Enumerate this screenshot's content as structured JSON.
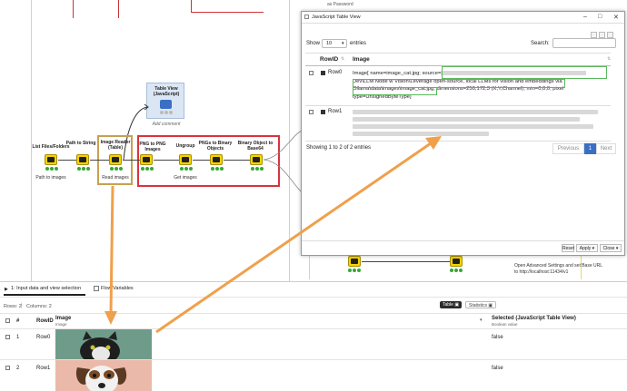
{
  "canvas": {
    "top_text": "as Password",
    "nodes": [
      {
        "title": "List Files/Folders",
        "sub": "Path to images"
      },
      {
        "title": "Path to String",
        "sub": ""
      },
      {
        "title": "Image Reader (Table)",
        "sub": "Read images"
      },
      {
        "title": "PNG to PNG Images",
        "sub": ""
      },
      {
        "title": "Ungroup",
        "sub": "Get images"
      },
      {
        "title": "PNGs to Binary Objects",
        "sub": ""
      },
      {
        "title": "Binary Object to Base64",
        "sub": ""
      }
    ],
    "table_view_node": {
      "title": "Table View (JavaScript)",
      "sub": "Add comment"
    },
    "lower_text_1": "Open Advanced Settings and set Base URL",
    "lower_text_2": "to http://localhost:11434/v1"
  },
  "jsview": {
    "title": "JavaScript Table View",
    "show_label": "Show",
    "entries_value": "10",
    "entries_label": "entries",
    "search_label": "Search:",
    "col_rowid": "RowID",
    "col_image": "Image",
    "rows": [
      {
        "rowid": "Row0",
        "line1": "Image[ name=image_cat.jpg; source=",
        "line2": "Dev\\LLM Node w Vision\\Leverage open-source, local LLMs for vision and embeddings via",
        "line3": "Ollama\\data\\images\\image_cat.jpg; dimensions=250,172,3 (X,Y,Channel); min=0,0,0; pixel",
        "line4": "type=UnsignedByteType]"
      },
      {
        "rowid": "Row1"
      }
    ],
    "info": "Showing 1 to 2 of 2 entries",
    "previous": "Previous",
    "page": "1",
    "next": "Next",
    "reset": "Reset",
    "apply": "Apply",
    "close": "Close"
  },
  "bottom": {
    "tab1": "1: Input data and view selection",
    "tab2": "Flow Variables",
    "rows_label": "Rows: 2",
    "cols_label": "Columns: 2",
    "table_btn": "Table",
    "stats_btn": "Statistics",
    "headers": {
      "num": "#",
      "rowid": "RowID",
      "image": "Image",
      "image_type": "Image",
      "selected": "Selected (JavaScript Table View)",
      "selected_type": "Boolean value"
    },
    "rows": [
      {
        "num": "1",
        "rowid": "Row0",
        "selected": "false"
      },
      {
        "num": "2",
        "rowid": "Row1",
        "selected": "false"
      }
    ]
  },
  "colors": {
    "orange_arrow": "#f0a04b",
    "red_box": "#d9333f",
    "green_box": "#5cb85c",
    "tan_box": "#c8a050",
    "accent_blue": "#3a6fc4"
  }
}
